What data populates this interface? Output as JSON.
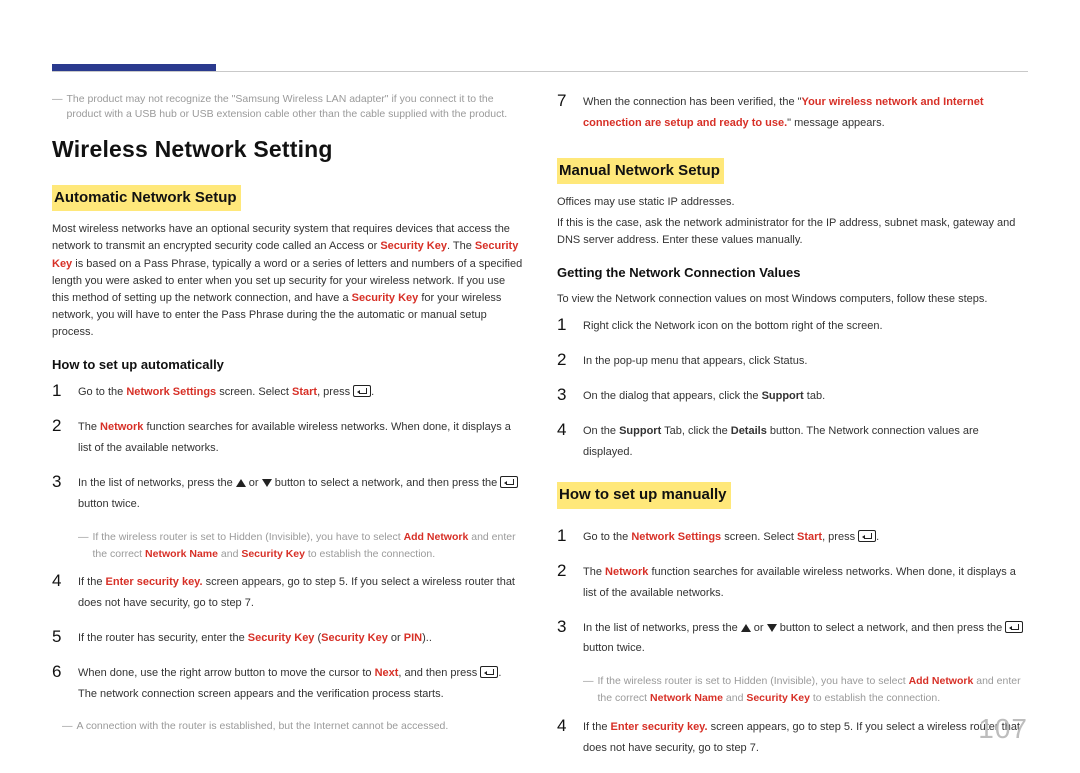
{
  "pageNumber": "107",
  "left": {
    "topNote": {
      "dash": "―",
      "text": "The product may not recognize the \"Samsung Wireless LAN adapter\" if you connect it to the product with a USB hub or USB extension cable other than the cable supplied with the product."
    },
    "h1": "Wireless Network Setting",
    "h2": "Automatic Network Setup",
    "intro": {
      "pre": "Most wireless networks have an optional security system that requires devices that access the network to transmit an encrypted security code called an Access or ",
      "sk1": "Security Key",
      "mid1": ". The ",
      "sk2": "Security Key",
      "mid2": " is based on a Pass Phrase, typically a word or a series of letters and numbers of a specified length you were asked to enter when you set up security for your wireless network. If you use this method of setting up the network connection, and have a ",
      "sk3": "Security Key",
      "post": " for your wireless network, you will have to enter the Pass Phrase during the the automatic or manual setup process."
    },
    "h3": "How to set up automatically",
    "steps": {
      "1": {
        "g1": "Go to the ",
        "ns": "Network Settings",
        "g2": " screen. Select ",
        "start": "Start",
        "g3": ", press "
      },
      "2": {
        "g1": "The ",
        "nw": "Network",
        "g2": " function searches for available wireless networks. When done, it displays a list of the available networks."
      },
      "3": {
        "g1": "In the list of networks, press the ",
        "g2": " or ",
        "g3": " button to select a network, and then press the ",
        "g4": " button twice."
      },
      "3note": {
        "dash": "―",
        "g1": "If the wireless router is set to Hidden (Invisible), you have to select ",
        "an": "Add Network",
        "g2": " and enter the correct ",
        "nn": "Network Name",
        "g3": " and ",
        "sk": "Security Key",
        "g4": " to establish the connection."
      },
      "4": {
        "g1": "If the ",
        "esk": "Enter security key.",
        "g2": " screen appears, go to step 5. If you select a wireless router that does not have security, go to step 7."
      },
      "5": {
        "g1": "If the router has security, enter the ",
        "sk": "Security Key",
        "g2": " (",
        "sk2": "Security Key",
        "g3": " or ",
        "pin": "PIN",
        "g4": ")."
      },
      "6": {
        "g1": "When done, use the right arrow button to move the cursor to ",
        "next": "Next",
        "g2": ", and then press ",
        "g3": ". The network connection screen appears and the verification process starts."
      }
    },
    "bottomNote": {
      "dash": "―",
      "text": "A connection with the router is established, but the Internet cannot be accessed."
    }
  },
  "right": {
    "step7": {
      "num": "7",
      "g1": "When the connection has been verified, the \"",
      "msg": "Your wireless network and Internet connection are setup and ready to use.",
      "g2": "\" message appears."
    },
    "h2": "Manual Network Setup",
    "p1": "Offices may use static IP addresses.",
    "p2": "If this is the case, ask the network administrator for the IP address, subnet mask, gateway and DNS server address. Enter these values manually.",
    "h3a": "Getting the Network Connection Values",
    "p3": "To view the Network connection values on most Windows computers, follow these steps.",
    "winSteps": {
      "1": "Right click the Network icon on the bottom right of the screen.",
      "2": "In the pop-up menu that appears, click Status.",
      "3": {
        "g1": "On the dialog that appears, click the ",
        "b1": "Support",
        "g2": " tab."
      },
      "4": {
        "g1": "On the ",
        "b1": "Support",
        "g2": " Tab, click the ",
        "b2": "Details",
        "g3": " button. The Network connection values are displayed."
      }
    },
    "h2b": "How to set up manually",
    "manSteps": {
      "1": {
        "g1": "Go to the ",
        "ns": "Network Settings",
        "g2": " screen. Select ",
        "start": "Start",
        "g3": ", press "
      },
      "2": {
        "g1": "The ",
        "nw": "Network",
        "g2": " function searches for available wireless networks. When done, it displays a list of the available networks."
      },
      "3": {
        "g1": "In the list of networks, press the ",
        "g2": " or ",
        "g3": " button to select a network, and then press the ",
        "g4": " button twice."
      },
      "3note": {
        "dash": "―",
        "g1": "If the wireless router is set to Hidden (Invisible), you have to select ",
        "an": "Add Network",
        "g2": " and enter the correct ",
        "nn": "Network Name",
        "g3": " and ",
        "sk": "Security Key",
        "g4": " to establish the connection."
      },
      "4": {
        "g1": "If the ",
        "esk": "Enter security key.",
        "g2": " screen appears, go to step 5. If you select a wireless router that does not have security, go to step 7."
      }
    }
  },
  "nums": {
    "1": "1",
    "2": "2",
    "3": "3",
    "4": "4",
    "5": "5",
    "6": "6",
    "7": "7"
  }
}
